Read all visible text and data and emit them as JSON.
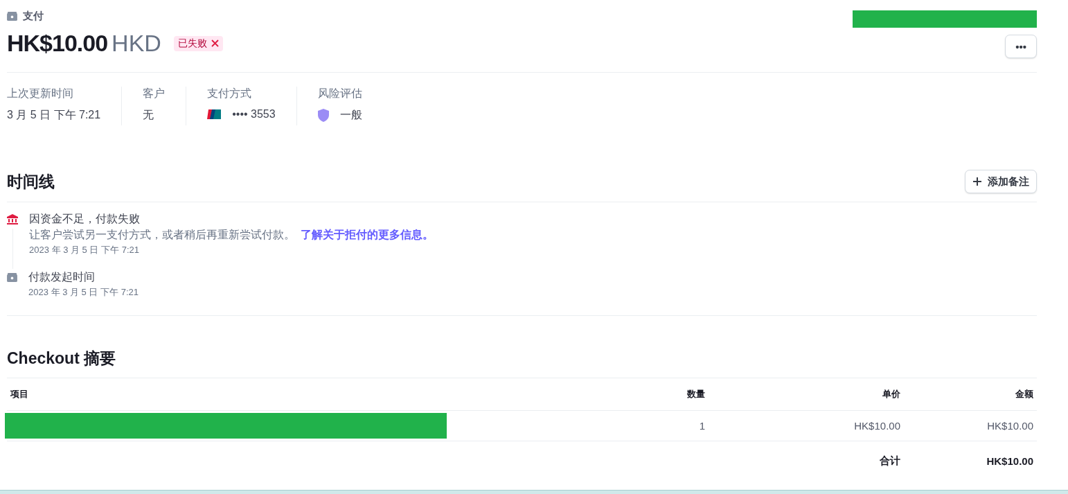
{
  "header": {
    "kind_label": "支付",
    "amount": "HK$10.00",
    "currency": "HKD",
    "status": {
      "label": "已失败",
      "kind": "failed"
    },
    "more_button": "•••"
  },
  "details": [
    {
      "label": "上次更新时间",
      "value": "3 月 5 日 下午 7:21",
      "kind": "text"
    },
    {
      "label": "客户",
      "value": "无",
      "kind": "text"
    },
    {
      "label": "支付方式",
      "value": "•••• 3553",
      "kind": "card"
    },
    {
      "label": "风险评估",
      "value": "一般",
      "kind": "risk"
    }
  ],
  "timeline": {
    "title": "时间线",
    "add_button": "添加备注",
    "events": [
      {
        "kind": "failed",
        "title": "因资金不足，付款失败",
        "description": "让客户尝试另一支付方式，或者稍后再重新尝试付款。",
        "link": "了解关于拒付的更多信息。",
        "time": "2023 年 3 月 5 日 下午 7:21"
      },
      {
        "kind": "created",
        "title": "付款发起时间",
        "time": "2023 年 3 月 5 日 下午 7:21"
      }
    ]
  },
  "checkout": {
    "title": "Checkout 摘要",
    "columns": [
      "项目",
      "数量",
      "单价",
      "金额"
    ],
    "rows": [
      {
        "quantity": "1",
        "unit_price": "HK$10.00",
        "amount": "HK$10.00"
      }
    ],
    "total_label": "合计",
    "total": "HK$10.00"
  }
}
